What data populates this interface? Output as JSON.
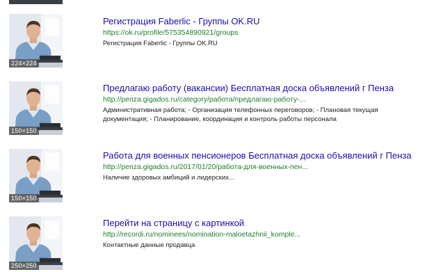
{
  "results": [
    {
      "title": "Регистрация Faberlic - Группы OK.RU",
      "url": "https://ok.ru/profile/575354890921/groups",
      "snippet": "Регистрация Faberlic - Группы OK.RU",
      "thumb_size": "224×224"
    },
    {
      "title": "Предлагаю работу (вакансии) Бесплатная доска объявлений г Пенза",
      "url": "http://penza.gigados.ru/category/работа/предлагаю-работу-...",
      "snippet": "Административная работа; - Организация телефонных переговоров; - Плановая текущая документация; - Планирование, координация и контроль работы персонала",
      "thumb_size": "150×150"
    },
    {
      "title": "Работа для военных пенсионеров Бесплатная доска объявлений г Пенза",
      "url": "http://penza.gigados.ru/2017/01/20/работа-для-военных-пен...",
      "snippet": "Наличие здоровых амбиций и лидерских...",
      "thumb_size": "150×150"
    },
    {
      "title": "Перейти на страницу с картинкой",
      "url": "http://recordi.ru/nominees/nomination-maloetazhnii_komple...",
      "snippet": "Контактные данные продавца",
      "thumb_size": "250×250"
    }
  ],
  "colors": {
    "title_link": "#1a0dab",
    "url_green": "#1e7d2c",
    "snippet_text": "#222222"
  }
}
